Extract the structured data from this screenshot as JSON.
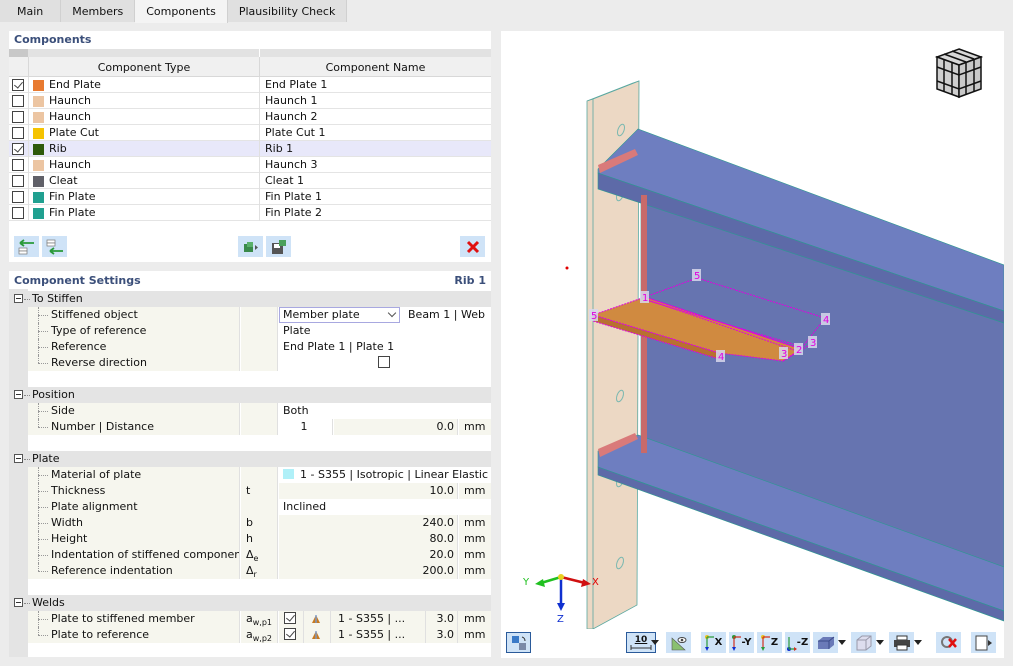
{
  "tabs": [
    {
      "label": "Main",
      "active": false
    },
    {
      "label": "Members",
      "active": false
    },
    {
      "label": "Components",
      "active": true
    },
    {
      "label": "Plausibility Check",
      "active": false
    }
  ],
  "components": {
    "title": "Components",
    "columns": {
      "type": "Component Type",
      "name": "Component Name"
    },
    "rows": [
      {
        "checked": true,
        "color": "#e87a30",
        "type": "End Plate",
        "name": "End Plate 1",
        "selected": false
      },
      {
        "checked": false,
        "color": "#ecc5a2",
        "type": "Haunch",
        "name": "Haunch 1",
        "selected": false
      },
      {
        "checked": false,
        "color": "#ecc5a2",
        "type": "Haunch",
        "name": "Haunch 2",
        "selected": false
      },
      {
        "checked": false,
        "color": "#f5c300",
        "type": "Plate Cut",
        "name": "Plate Cut 1",
        "selected": false
      },
      {
        "checked": true,
        "color": "#2e5a0a",
        "type": "Rib",
        "name": "Rib 1",
        "selected": true
      },
      {
        "checked": false,
        "color": "#ecc5a2",
        "type": "Haunch",
        "name": "Haunch 3",
        "selected": false
      },
      {
        "checked": false,
        "color": "#606068",
        "type": "Cleat",
        "name": "Cleat 1",
        "selected": false
      },
      {
        "checked": false,
        "color": "#20a090",
        "type": "Fin Plate",
        "name": "Fin Plate 1",
        "selected": false
      },
      {
        "checked": false,
        "color": "#20a090",
        "type": "Fin Plate",
        "name": "Fin Plate 2",
        "selected": false
      }
    ],
    "buttons": {
      "insert_before": "insert-before-icon",
      "insert_after": "insert-after-icon",
      "import": "import-component-icon",
      "save": "save-component-icon",
      "delete": "delete-icon"
    }
  },
  "settings": {
    "title": "Component Settings",
    "current": "Rib 1",
    "groups": {
      "to_stiffen": {
        "label": "To Stiffen",
        "stiffened_object": {
          "label": "Stiffened object",
          "value": "Member plate",
          "extra": "Beam 1 | Web"
        },
        "type_of_reference": {
          "label": "Type of reference",
          "value": "Plate"
        },
        "reference": {
          "label": "Reference",
          "value": "End Plate 1 | Plate 1"
        },
        "reverse_direction": {
          "label": "Reverse direction",
          "checked": false
        }
      },
      "position": {
        "label": "Position",
        "side": {
          "label": "Side",
          "value": "Both"
        },
        "number_distance": {
          "label": "Number | Distance",
          "number": "1",
          "distance": "0.0",
          "unit": "mm"
        }
      },
      "plate": {
        "label": "Plate",
        "material": {
          "label": "Material of plate",
          "value": "1 - S355 | Isotropic | Linear Elastic",
          "color": "#b0f0f8"
        },
        "thickness": {
          "label": "Thickness",
          "symbol": "t",
          "value": "10.0",
          "unit": "mm"
        },
        "alignment": {
          "label": "Plate alignment",
          "value": "Inclined"
        },
        "width": {
          "label": "Width",
          "symbol": "b",
          "value": "240.0",
          "unit": "mm"
        },
        "height": {
          "label": "Height",
          "symbol": "h",
          "value": "80.0",
          "unit": "mm"
        },
        "indent_stiffened": {
          "label": "Indentation of stiffened component",
          "symbol": "Δ",
          "sub": "e",
          "value": "20.0",
          "unit": "mm"
        },
        "indent_reference": {
          "label": "Reference indentation",
          "symbol": "Δ",
          "sub": "r",
          "value": "200.0",
          "unit": "mm"
        }
      },
      "welds": {
        "label": "Welds",
        "w1": {
          "label": "Plate to stiffened member",
          "symbol": "a",
          "sub": "w,p1",
          "checked": true,
          "material": "1 - S355 | ...",
          "value": "3.0",
          "unit": "mm"
        },
        "w2": {
          "label": "Plate to reference",
          "symbol": "a",
          "sub": "w,p2",
          "checked": true,
          "material": "1 - S355 | ...",
          "value": "3.0",
          "unit": "mm"
        }
      }
    }
  },
  "viewport": {
    "axes": {
      "x": "X",
      "y": "Y",
      "z": "Z"
    },
    "node_labels": [
      "1",
      "2",
      "3",
      "3",
      "4",
      "4",
      "5",
      "5"
    ],
    "toolbar": {
      "scale_label": "10",
      "view_x": "X",
      "view_minus_y": "-Y",
      "view_z": "Z",
      "view_minus_z": "-Z"
    },
    "colors": {
      "beam": "#6b78bb",
      "end_plate": "#ecd8c4",
      "weld": "#d97a7a",
      "rib": "#d08a40",
      "highlight": "#e000e0"
    }
  }
}
